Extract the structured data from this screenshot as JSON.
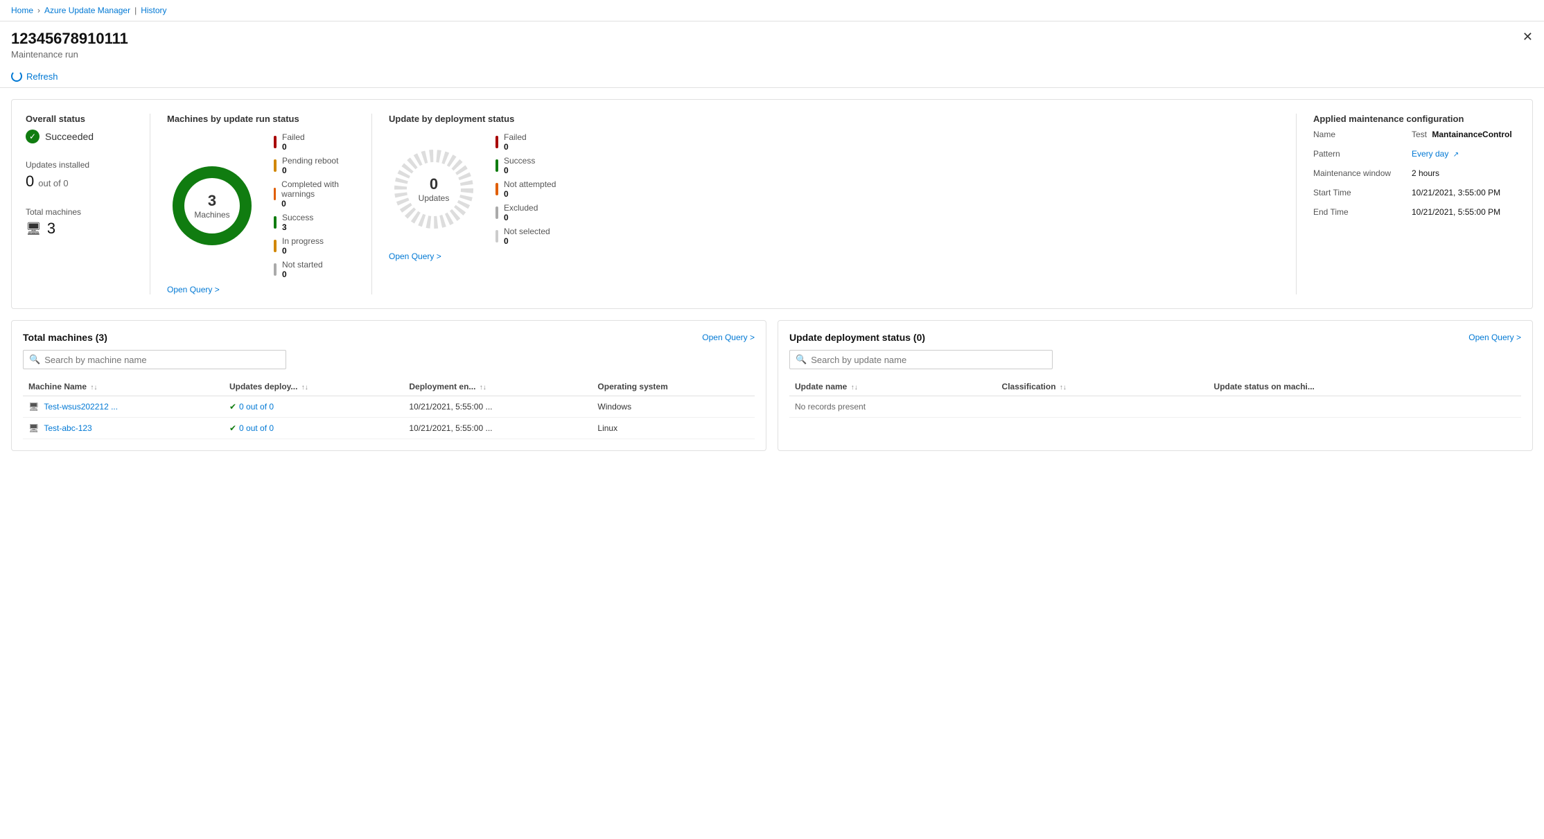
{
  "breadcrumb": {
    "home": "Home",
    "azure_update_manager": "Azure Update Manager",
    "history": "History"
  },
  "header": {
    "title": "12345678910111",
    "subtitle": "Maintenance run",
    "close_label": "✕"
  },
  "toolbar": {
    "refresh_label": "Refresh"
  },
  "summary": {
    "overall_status": {
      "label": "Overall status",
      "value": "Succeeded"
    },
    "updates_installed": {
      "label": "Updates installed",
      "value": "0",
      "suffix": "out of 0"
    },
    "total_machines": {
      "label": "Total machines",
      "value": "3"
    }
  },
  "machines_chart": {
    "title": "Machines by update run status",
    "center_num": "3",
    "center_label": "Machines",
    "legend": [
      {
        "label": "Failed",
        "value": "0",
        "color": "#a80000"
      },
      {
        "label": "Pending reboot",
        "value": "0",
        "color": "#d18700"
      },
      {
        "label": "Completed with warnings",
        "value": "0",
        "color": "#e05e00"
      },
      {
        "label": "Success",
        "value": "3",
        "color": "#107c10"
      },
      {
        "label": "In progress",
        "value": "0",
        "color": "#d18700"
      },
      {
        "label": "Not started",
        "value": "0",
        "color": "#aaa"
      }
    ],
    "open_query": "Open Query >"
  },
  "deployment_chart": {
    "title": "Update by deployment status",
    "center_num": "0",
    "center_label": "Updates",
    "legend": [
      {
        "label": "Failed",
        "value": "0",
        "color": "#a80000"
      },
      {
        "label": "Success",
        "value": "0",
        "color": "#107c10"
      },
      {
        "label": "Not attempted",
        "value": "0",
        "color": "#e05e00"
      },
      {
        "label": "Excluded",
        "value": "0",
        "color": "#aaa"
      },
      {
        "label": "Not selected",
        "value": "0",
        "color": "#ccc"
      }
    ],
    "open_query": "Open Query >"
  },
  "config": {
    "title": "Applied maintenance configuration",
    "name_label": "Name",
    "name_prefix": "Test",
    "name_value": "MantainanceControl",
    "pattern_label": "Pattern",
    "pattern_value": "Every day",
    "maintenance_window_label": "Maintenance window",
    "maintenance_window_value": "2 hours",
    "start_time_label": "Start Time",
    "start_time_value": "10/21/2021, 3:55:00 PM",
    "end_time_label": "End Time",
    "end_time_value": "10/21/2021, 5:55:00 PM"
  },
  "machines_panel": {
    "title": "Total machines (3)",
    "open_query": "Open Query >",
    "search_placeholder": "Search by machine name",
    "columns": [
      "Machine Name",
      "Updates deploy...",
      "Deployment en...",
      "Operating system"
    ],
    "rows": [
      {
        "name": "Test-wsus202212 ...",
        "updates": "0 out of 0",
        "deployment_end": "10/21/2021, 5:55:00 ...",
        "os": "Windows"
      },
      {
        "name": "Test-abc-123",
        "updates": "0 out of 0",
        "deployment_end": "10/21/2021, 5:55:00 ...",
        "os": "Linux"
      }
    ]
  },
  "updates_panel": {
    "title": "Update deployment status (0)",
    "open_query": "Open Query >",
    "search_placeholder": "Search by update name",
    "columns": [
      "Update name",
      "Classification",
      "Update status on machi..."
    ],
    "no_records": "No records present"
  }
}
